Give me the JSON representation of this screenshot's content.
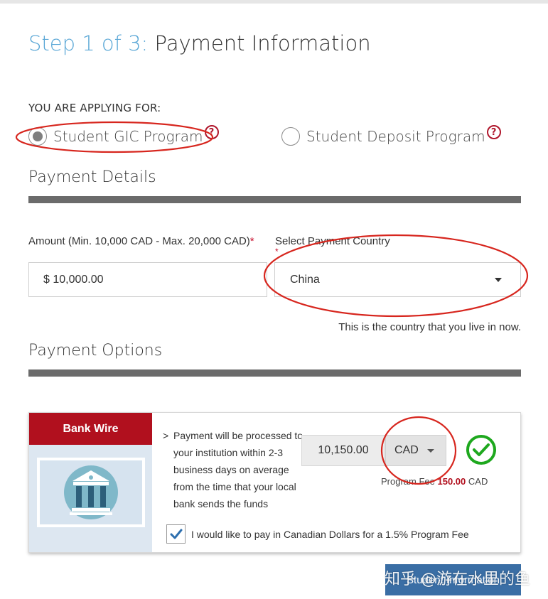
{
  "header": {
    "step_prefix": "Step 1 of 3:",
    "step_title": "Payment Information"
  },
  "applying": {
    "label": "YOU ARE APPLYING FOR:",
    "options": [
      {
        "label": "Student GIC Program",
        "selected": true
      },
      {
        "label": "Student Deposit Program",
        "selected": false
      }
    ],
    "help_glyph": "?"
  },
  "payment_details": {
    "heading": "Payment Details",
    "amount_label": "Amount (Min. 10,000 CAD - Max. 20,000 CAD)",
    "amount_value": "$ 10,000.00",
    "country_label": "Select Payment Country",
    "country_value": "China",
    "country_hint": "This is the country that you live in now.",
    "required_mark": "*"
  },
  "payment_options": {
    "heading": "Payment Options",
    "bank_wire": {
      "title": "Bank Wire",
      "arrow": ">",
      "description": "Payment will be processed to your institution within 2-3 business days on average from the time that your local bank sends the funds",
      "converted_amount": "10,150.00",
      "currency": "CAD",
      "fee_label": "Program Fee",
      "fee_value": "150.00",
      "fee_currency": "CAD",
      "cad_checkbox_checked": true,
      "cad_checkbox_label": "I would like to pay in Canadian Dollars for a 1.5% Program Fee"
    }
  },
  "footer": {
    "submit_label": "Student Information"
  },
  "watermark": "知乎 @游在水里的鱼",
  "colors": {
    "accent_blue": "#5aa7d6",
    "brand_red": "#b1101e",
    "success_green": "#1ea81e",
    "annotation_red": "#d7261e",
    "button_blue": "#3a6ea5"
  }
}
